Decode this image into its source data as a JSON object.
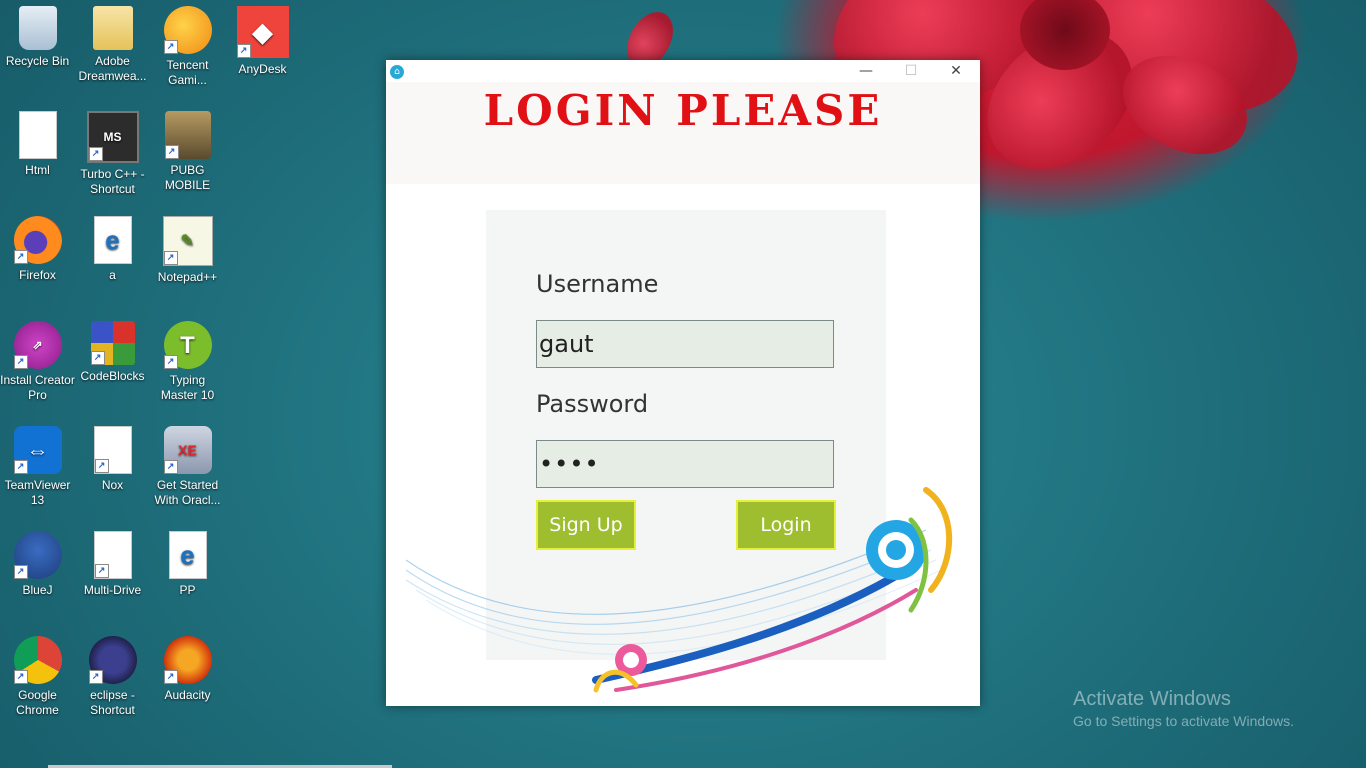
{
  "desktop": {
    "icons": [
      {
        "label": "Recycle Bin",
        "glyph": "recycle-bin-icon"
      },
      {
        "label": "Adobe Dreamwea...",
        "glyph": "folder-icon"
      },
      {
        "label": "Tencent Gami...",
        "glyph": "tencent-gaming-icon"
      },
      {
        "label": "AnyDesk",
        "glyph": "anydesk-icon"
      },
      {
        "label": "Html",
        "glyph": "file-icon"
      },
      {
        "label": "Turbo C++ - Shortcut",
        "glyph": "turbo-cpp-icon"
      },
      {
        "label": "PUBG MOBILE",
        "glyph": "pubg-icon"
      },
      {
        "label": "Firefox",
        "glyph": "firefox-icon"
      },
      {
        "label": "a",
        "glyph": "edge-file-icon"
      },
      {
        "label": "Notepad++",
        "glyph": "notepadpp-icon"
      },
      {
        "label": "Install Creator Pro",
        "glyph": "install-creator-icon"
      },
      {
        "label": "CodeBlocks",
        "glyph": "codeblocks-icon"
      },
      {
        "label": "Typing Master 10",
        "glyph": "typing-master-icon"
      },
      {
        "label": "TeamViewer 13",
        "glyph": "teamviewer-icon"
      },
      {
        "label": "Nox",
        "glyph": "file-icon"
      },
      {
        "label": "Get Started With Oracl...",
        "glyph": "oracle-db-icon"
      },
      {
        "label": "BlueJ",
        "glyph": "bluej-icon"
      },
      {
        "label": "Multi-Drive",
        "glyph": "file-icon"
      },
      {
        "label": "PP",
        "glyph": "edge-file-icon"
      },
      {
        "label": "Google Chrome",
        "glyph": "chrome-icon"
      },
      {
        "label": "eclipse - Shortcut",
        "glyph": "eclipse-icon"
      },
      {
        "label": "Audacity",
        "glyph": "audacity-icon"
      }
    ],
    "watermark": {
      "line1": "Activate Windows",
      "line2": "Go to Settings to activate Windows."
    }
  },
  "window": {
    "title_glyph": "⌂",
    "minimize": "—",
    "maximize": "☐",
    "close": "✕",
    "heading": "LOGIN PLEASE",
    "username_label": "Username",
    "username_value": "gaut",
    "password_label": "Password",
    "password_value": "••••",
    "signup_label": "Sign Up",
    "login_label": "Login",
    "colors": {
      "heading": "#e01014",
      "button": "#9ebd2f",
      "button_border": "#e6f03a",
      "field": "#e5ede5"
    }
  }
}
